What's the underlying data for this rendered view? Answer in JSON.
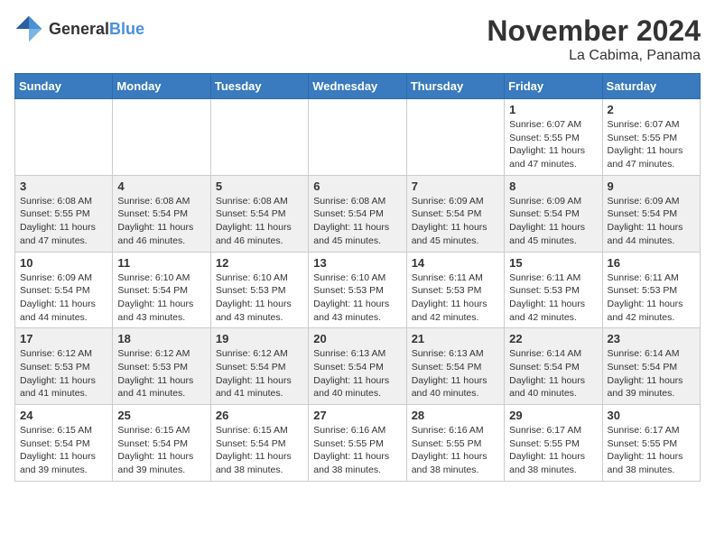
{
  "header": {
    "logo_general": "General",
    "logo_blue": "Blue",
    "title": "November 2024",
    "location": "La Cabima, Panama"
  },
  "calendar": {
    "days": [
      "Sunday",
      "Monday",
      "Tuesday",
      "Wednesday",
      "Thursday",
      "Friday",
      "Saturday"
    ],
    "weeks": [
      [
        {
          "day": "",
          "info": ""
        },
        {
          "day": "",
          "info": ""
        },
        {
          "day": "",
          "info": ""
        },
        {
          "day": "",
          "info": ""
        },
        {
          "day": "",
          "info": ""
        },
        {
          "day": "1",
          "info": "Sunrise: 6:07 AM\nSunset: 5:55 PM\nDaylight: 11 hours and 47 minutes."
        },
        {
          "day": "2",
          "info": "Sunrise: 6:07 AM\nSunset: 5:55 PM\nDaylight: 11 hours and 47 minutes."
        }
      ],
      [
        {
          "day": "3",
          "info": "Sunrise: 6:08 AM\nSunset: 5:55 PM\nDaylight: 11 hours and 47 minutes."
        },
        {
          "day": "4",
          "info": "Sunrise: 6:08 AM\nSunset: 5:54 PM\nDaylight: 11 hours and 46 minutes."
        },
        {
          "day": "5",
          "info": "Sunrise: 6:08 AM\nSunset: 5:54 PM\nDaylight: 11 hours and 46 minutes."
        },
        {
          "day": "6",
          "info": "Sunrise: 6:08 AM\nSunset: 5:54 PM\nDaylight: 11 hours and 45 minutes."
        },
        {
          "day": "7",
          "info": "Sunrise: 6:09 AM\nSunset: 5:54 PM\nDaylight: 11 hours and 45 minutes."
        },
        {
          "day": "8",
          "info": "Sunrise: 6:09 AM\nSunset: 5:54 PM\nDaylight: 11 hours and 45 minutes."
        },
        {
          "day": "9",
          "info": "Sunrise: 6:09 AM\nSunset: 5:54 PM\nDaylight: 11 hours and 44 minutes."
        }
      ],
      [
        {
          "day": "10",
          "info": "Sunrise: 6:09 AM\nSunset: 5:54 PM\nDaylight: 11 hours and 44 minutes."
        },
        {
          "day": "11",
          "info": "Sunrise: 6:10 AM\nSunset: 5:54 PM\nDaylight: 11 hours and 43 minutes."
        },
        {
          "day": "12",
          "info": "Sunrise: 6:10 AM\nSunset: 5:53 PM\nDaylight: 11 hours and 43 minutes."
        },
        {
          "day": "13",
          "info": "Sunrise: 6:10 AM\nSunset: 5:53 PM\nDaylight: 11 hours and 43 minutes."
        },
        {
          "day": "14",
          "info": "Sunrise: 6:11 AM\nSunset: 5:53 PM\nDaylight: 11 hours and 42 minutes."
        },
        {
          "day": "15",
          "info": "Sunrise: 6:11 AM\nSunset: 5:53 PM\nDaylight: 11 hours and 42 minutes."
        },
        {
          "day": "16",
          "info": "Sunrise: 6:11 AM\nSunset: 5:53 PM\nDaylight: 11 hours and 42 minutes."
        }
      ],
      [
        {
          "day": "17",
          "info": "Sunrise: 6:12 AM\nSunset: 5:53 PM\nDaylight: 11 hours and 41 minutes."
        },
        {
          "day": "18",
          "info": "Sunrise: 6:12 AM\nSunset: 5:53 PM\nDaylight: 11 hours and 41 minutes."
        },
        {
          "day": "19",
          "info": "Sunrise: 6:12 AM\nSunset: 5:54 PM\nDaylight: 11 hours and 41 minutes."
        },
        {
          "day": "20",
          "info": "Sunrise: 6:13 AM\nSunset: 5:54 PM\nDaylight: 11 hours and 40 minutes."
        },
        {
          "day": "21",
          "info": "Sunrise: 6:13 AM\nSunset: 5:54 PM\nDaylight: 11 hours and 40 minutes."
        },
        {
          "day": "22",
          "info": "Sunrise: 6:14 AM\nSunset: 5:54 PM\nDaylight: 11 hours and 40 minutes."
        },
        {
          "day": "23",
          "info": "Sunrise: 6:14 AM\nSunset: 5:54 PM\nDaylight: 11 hours and 39 minutes."
        }
      ],
      [
        {
          "day": "24",
          "info": "Sunrise: 6:15 AM\nSunset: 5:54 PM\nDaylight: 11 hours and 39 minutes."
        },
        {
          "day": "25",
          "info": "Sunrise: 6:15 AM\nSunset: 5:54 PM\nDaylight: 11 hours and 39 minutes."
        },
        {
          "day": "26",
          "info": "Sunrise: 6:15 AM\nSunset: 5:54 PM\nDaylight: 11 hours and 38 minutes."
        },
        {
          "day": "27",
          "info": "Sunrise: 6:16 AM\nSunset: 5:55 PM\nDaylight: 11 hours and 38 minutes."
        },
        {
          "day": "28",
          "info": "Sunrise: 6:16 AM\nSunset: 5:55 PM\nDaylight: 11 hours and 38 minutes."
        },
        {
          "day": "29",
          "info": "Sunrise: 6:17 AM\nSunset: 5:55 PM\nDaylight: 11 hours and 38 minutes."
        },
        {
          "day": "30",
          "info": "Sunrise: 6:17 AM\nSunset: 5:55 PM\nDaylight: 11 hours and 38 minutes."
        }
      ]
    ]
  }
}
